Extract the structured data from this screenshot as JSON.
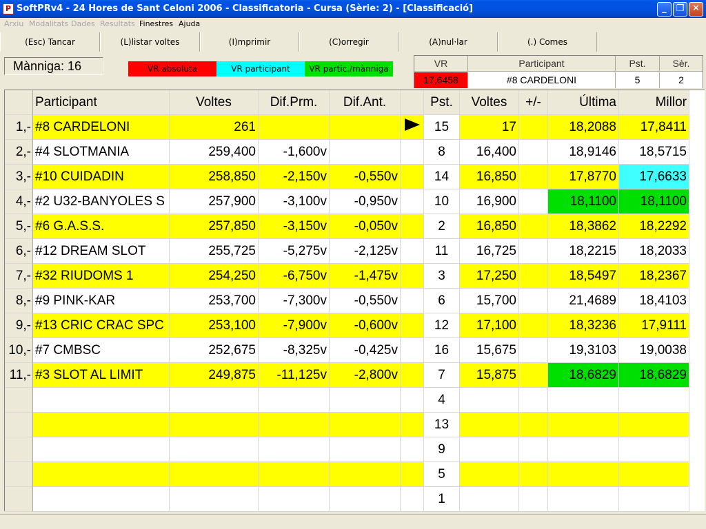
{
  "window": {
    "title": "SoftPRv4 - 24 Hores de Sant Celoni 2006 - Classificatoria - Cursa (Sèrie: 2) - [Classificació]",
    "icon_letter": "P"
  },
  "menu": {
    "items": [
      {
        "label": "Arxiu",
        "enabled": false
      },
      {
        "label": "Modalitats",
        "enabled": false
      },
      {
        "label": "Dades",
        "enabled": false
      },
      {
        "label": "Resultats",
        "enabled": false
      },
      {
        "label": "Finestres",
        "enabled": true
      },
      {
        "label": "Ajuda",
        "enabled": true
      }
    ]
  },
  "toolbar": {
    "buttons": [
      {
        "label": "(Esc) Tancar"
      },
      {
        "label": "(L)listar voltes"
      },
      {
        "label": "(I)mprimir"
      },
      {
        "label": "(C)orregir"
      },
      {
        "label": "(A)nul·lar"
      },
      {
        "label": "(.) Comes"
      }
    ]
  },
  "maniga": {
    "label": "Mànniga: 16"
  },
  "legend": {
    "absolute": {
      "label": "VR absoluta",
      "color": "#ff0000"
    },
    "participant": {
      "label": "VR participant",
      "color": "#00ffff"
    },
    "maniga": {
      "label": "VR partic./mànniga",
      "color": "#00e000"
    }
  },
  "vr_panel": {
    "headers": [
      "VR",
      "Participant",
      "Pst.",
      "Sèr."
    ],
    "values": [
      "17,6458",
      "#8 CARDELONI",
      "5",
      "2"
    ]
  },
  "table": {
    "headers": {
      "participant": "Participant",
      "voltes": "Voltes",
      "dif_prm": "Dif.Prm.",
      "dif_ant": "Dif.Ant.",
      "pst": "Pst.",
      "voltes2": "Voltes",
      "plusminus": "+/-",
      "ultima": "Última",
      "millor": "Millor"
    },
    "rows": [
      {
        "pos": "1,-",
        "participant": "#8 CARDELONI",
        "voltes": "261",
        "dif_prm": "",
        "dif_ant": "",
        "current": true,
        "pst": "15",
        "voltes2": "17",
        "pm": "",
        "ultima": "18,2088",
        "millor": "17,8411",
        "row_color": "yellow",
        "ultima_color": "",
        "millor_color": ""
      },
      {
        "pos": "2,-",
        "participant": "#4 SLOTMANIA",
        "voltes": "259,400",
        "dif_prm": "-1,600v",
        "dif_ant": "",
        "current": false,
        "pst": "8",
        "voltes2": "16,400",
        "pm": "",
        "ultima": "18,9146",
        "millor": "18,5715",
        "row_color": "white",
        "ultima_color": "",
        "millor_color": ""
      },
      {
        "pos": "3,-",
        "participant": "#10 CUIDADIN",
        "voltes": "258,850",
        "dif_prm": "-2,150v",
        "dif_ant": "-0,550v",
        "current": false,
        "pst": "14",
        "voltes2": "16,850",
        "pm": "",
        "ultima": "17,8770",
        "millor": "17,6633",
        "row_color": "yellow",
        "ultima_color": "",
        "millor_color": "cyan"
      },
      {
        "pos": "4,-",
        "participant": "#2 U32-BANYOLES S",
        "voltes": "257,900",
        "dif_prm": "-3,100v",
        "dif_ant": "-0,950v",
        "current": false,
        "pst": "10",
        "voltes2": "16,900",
        "pm": "",
        "ultima": "18,1100",
        "millor": "18,1100",
        "row_color": "white",
        "ultima_color": "green",
        "millor_color": "green"
      },
      {
        "pos": "5,-",
        "participant": "#6 G.A.S.S.",
        "voltes": "257,850",
        "dif_prm": "-3,150v",
        "dif_ant": "-0,050v",
        "current": false,
        "pst": "2",
        "voltes2": "16,850",
        "pm": "",
        "ultima": "18,3862",
        "millor": "18,2292",
        "row_color": "yellow",
        "ultima_color": "",
        "millor_color": ""
      },
      {
        "pos": "6,-",
        "participant": "#12 DREAM SLOT",
        "voltes": "255,725",
        "dif_prm": "-5,275v",
        "dif_ant": "-2,125v",
        "current": false,
        "pst": "11",
        "voltes2": "16,725",
        "pm": "",
        "ultima": "18,2215",
        "millor": "18,2033",
        "row_color": "white",
        "ultima_color": "",
        "millor_color": ""
      },
      {
        "pos": "7,-",
        "participant": "#32 RIUDOMS 1",
        "voltes": "254,250",
        "dif_prm": "-6,750v",
        "dif_ant": "-1,475v",
        "current": false,
        "pst": "3",
        "voltes2": "17,250",
        "pm": "",
        "ultima": "18,5497",
        "millor": "18,2367",
        "row_color": "yellow",
        "ultima_color": "",
        "millor_color": ""
      },
      {
        "pos": "8,-",
        "participant": "#9 PINK-KAR",
        "voltes": "253,700",
        "dif_prm": "-7,300v",
        "dif_ant": "-0,550v",
        "current": false,
        "pst": "6",
        "voltes2": "15,700",
        "pm": "",
        "ultima": "21,4689",
        "millor": "18,4103",
        "row_color": "white",
        "ultima_color": "",
        "millor_color": ""
      },
      {
        "pos": "9,-",
        "participant": "#13 CRIC CRAC SPC",
        "voltes": "253,100",
        "dif_prm": "-7,900v",
        "dif_ant": "-0,600v",
        "current": false,
        "pst": "12",
        "voltes2": "17,100",
        "pm": "",
        "ultima": "18,3236",
        "millor": "17,9111",
        "row_color": "yellow",
        "ultima_color": "",
        "millor_color": ""
      },
      {
        "pos": "10,-",
        "participant": "#7 CMBSC",
        "voltes": "252,675",
        "dif_prm": "-8,325v",
        "dif_ant": "-0,425v",
        "current": false,
        "pst": "16",
        "voltes2": "15,675",
        "pm": "",
        "ultima": "19,3103",
        "millor": "19,0038",
        "row_color": "white",
        "ultima_color": "",
        "millor_color": ""
      },
      {
        "pos": "11,-",
        "participant": "#3 SLOT AL LIMIT",
        "voltes": "249,875",
        "dif_prm": "-11,125v",
        "dif_ant": "-2,800v",
        "current": false,
        "pst": "7",
        "voltes2": "15,875",
        "pm": "",
        "ultima": "18,6829",
        "millor": "18,6829",
        "row_color": "yellow",
        "ultima_color": "green",
        "millor_color": "green"
      },
      {
        "pos": "",
        "participant": "",
        "voltes": "",
        "dif_prm": "",
        "dif_ant": "",
        "current": false,
        "pst": "4",
        "voltes2": "",
        "pm": "",
        "ultima": "",
        "millor": "",
        "row_color": "white",
        "ultima_color": "",
        "millor_color": ""
      },
      {
        "pos": "",
        "participant": "",
        "voltes": "",
        "dif_prm": "",
        "dif_ant": "",
        "current": false,
        "pst": "13",
        "voltes2": "",
        "pm": "",
        "ultima": "",
        "millor": "",
        "row_color": "yellow",
        "ultima_color": "",
        "millor_color": ""
      },
      {
        "pos": "",
        "participant": "",
        "voltes": "",
        "dif_prm": "",
        "dif_ant": "",
        "current": false,
        "pst": "9",
        "voltes2": "",
        "pm": "",
        "ultima": "",
        "millor": "",
        "row_color": "white",
        "ultima_color": "",
        "millor_color": ""
      },
      {
        "pos": "",
        "participant": "",
        "voltes": "",
        "dif_prm": "",
        "dif_ant": "",
        "current": false,
        "pst": "5",
        "voltes2": "",
        "pm": "",
        "ultima": "",
        "millor": "",
        "row_color": "yellow",
        "ultima_color": "",
        "millor_color": ""
      },
      {
        "pos": "",
        "participant": "",
        "voltes": "",
        "dif_prm": "",
        "dif_ant": "",
        "current": false,
        "pst": "1",
        "voltes2": "",
        "pm": "",
        "ultima": "",
        "millor": "",
        "row_color": "white",
        "ultima_color": "",
        "millor_color": ""
      }
    ]
  },
  "colors": {
    "yellow": "#ffff00",
    "green": "#00e000",
    "cyan": "#40ffff",
    "red": "#ff0000"
  }
}
